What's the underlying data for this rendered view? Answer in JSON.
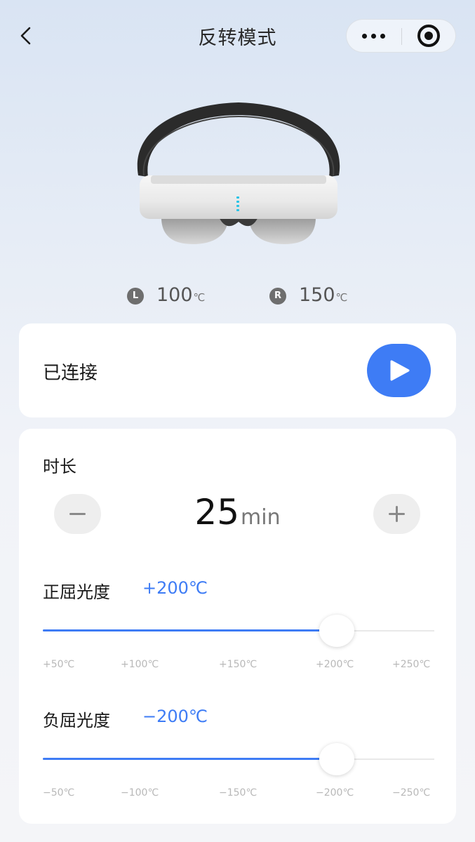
{
  "header": {
    "title": "反转模式",
    "back_icon": "chevron-left-icon",
    "more_icon": "more-dots-icon",
    "close_icon": "target-circle-icon"
  },
  "device": {
    "image_icon": "vr-headset-image",
    "left": {
      "badge": "L",
      "value": "100",
      "unit": "℃"
    },
    "right": {
      "badge": "R",
      "value": "150",
      "unit": "℃"
    }
  },
  "connection": {
    "status": "已连接",
    "play_icon": "play-icon"
  },
  "duration": {
    "label": "时长",
    "value": "25",
    "unit": "min",
    "minus_icon": "minus-icon",
    "plus_icon": "plus-icon"
  },
  "positive": {
    "label": "正屈光度",
    "value": "+200℃",
    "level_percent": 75,
    "ticks": [
      "+50℃",
      "+100℃",
      "+150℃",
      "+200℃",
      "+250℃"
    ]
  },
  "negative": {
    "label": "负屈光度",
    "value": "−200℃",
    "level_percent": 75,
    "ticks": [
      "−50℃",
      "−100℃",
      "−150℃",
      "−200℃",
      "−250℃"
    ]
  },
  "colors": {
    "accent": "#3e7cf5",
    "card": "#ffffff",
    "muted": "#b8b8b8"
  }
}
